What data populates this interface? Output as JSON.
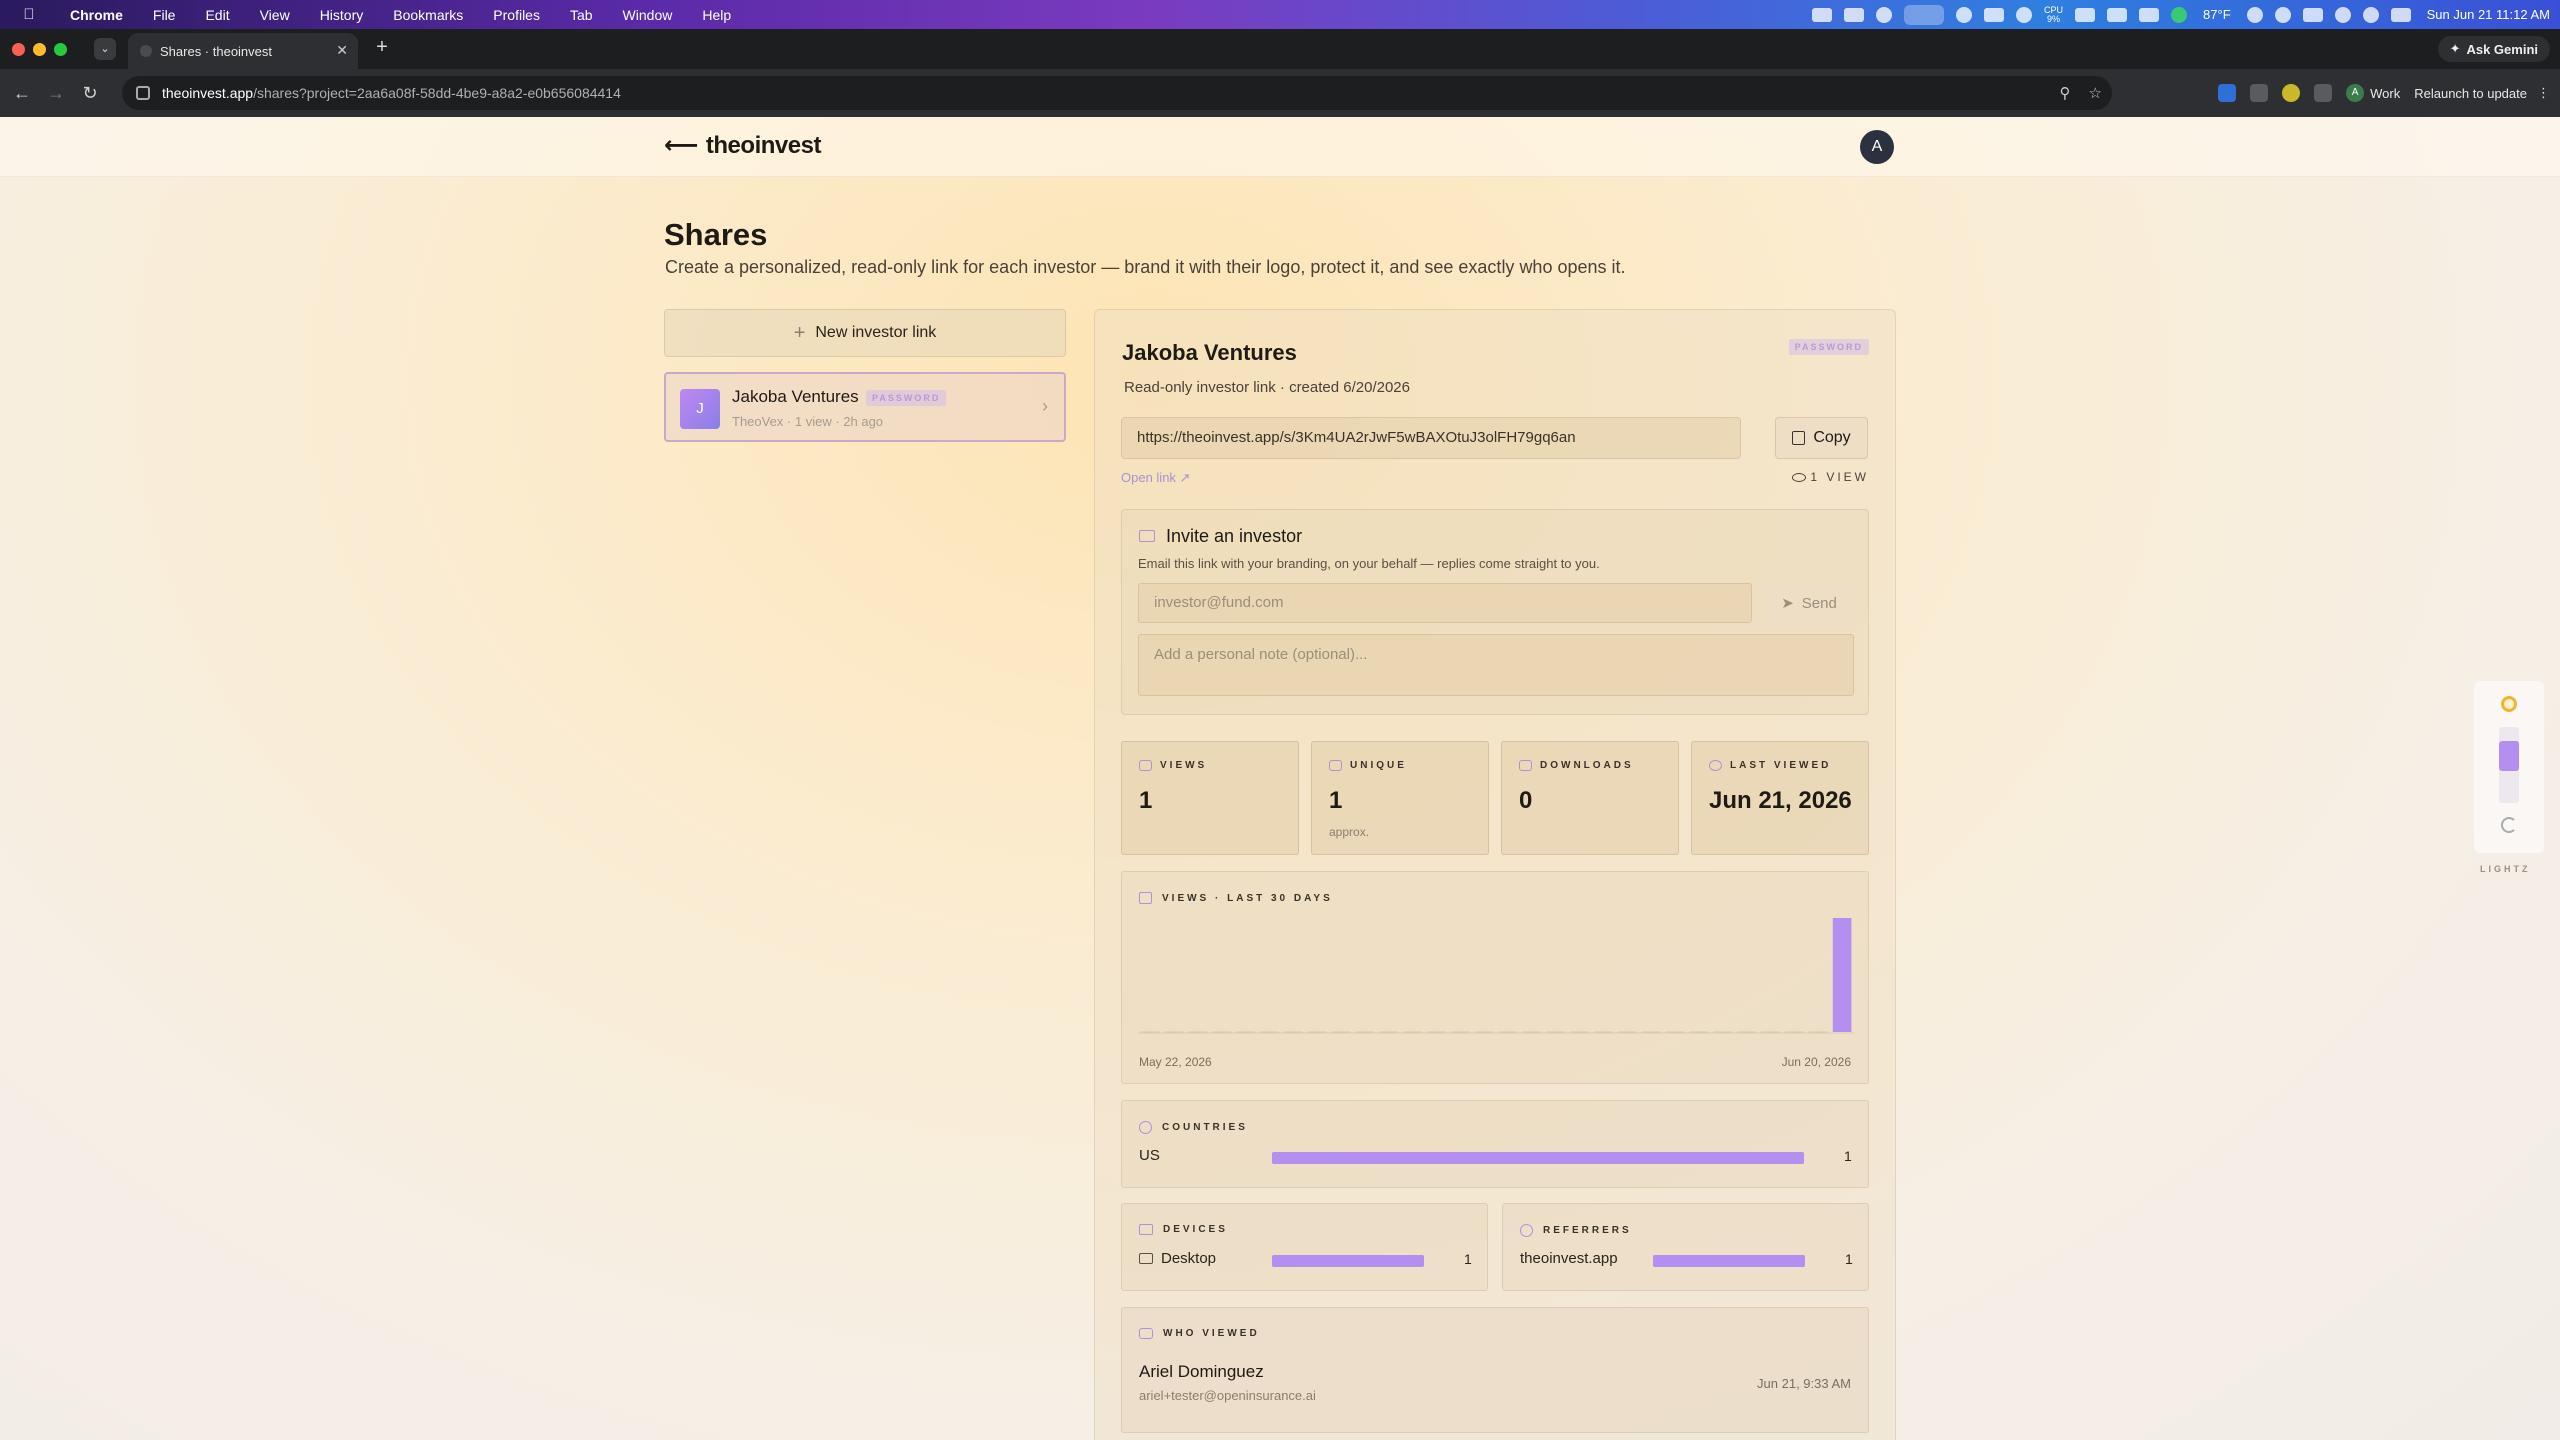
{
  "menubar": {
    "app": "Chrome",
    "items": [
      "File",
      "Edit",
      "View",
      "History",
      "Bookmarks",
      "Profiles",
      "Tab",
      "Window",
      "Help"
    ],
    "cpu_label": "CPU",
    "cpu_value": "9%",
    "temperature": "87°F",
    "datetime": "Sun Jun 21  11:12 AM"
  },
  "browser": {
    "tab_title": "Shares · theoinvest",
    "ask_gemini": "Ask Gemini",
    "url_host": "theoinvest.app",
    "url_path": "/shares?project=2aa6a08f-58dd-4be9-a8a2-e0b656084414",
    "profile_initial": "A",
    "profile_name": "Work",
    "relaunch": "Relaunch to update"
  },
  "header": {
    "logo": "theoinvest",
    "avatar_initial": "A"
  },
  "page": {
    "title": "Shares",
    "subtitle": "Create a personalized, read-only link for each investor — brand it with their logo, protect it, and see exactly who opens it.",
    "new_link_label": "New investor link"
  },
  "investors": [
    {
      "initial": "J",
      "name": "Jakoba Ventures",
      "badge": "PASSWORD",
      "meta": "TheoVex · 1 view · 2h ago"
    }
  ],
  "detail": {
    "name": "Jakoba Ventures",
    "badge": "PASSWORD",
    "subtitle": "Read-only investor link · created 6/20/2026",
    "share_url": "https://theoinvest.app/s/3Km4UA2rJwF5wBAXOtuJ3olFH79gq6an",
    "copy_label": "Copy",
    "open_link_label": "Open link",
    "views_label": "1 VIEW",
    "invite": {
      "title": "Invite an investor",
      "subtitle": "Email this link with your branding, on your behalf — replies come straight to you.",
      "email_placeholder": "investor@fund.com",
      "send_label": "Send",
      "note_placeholder": "Add a personal note (optional)..."
    },
    "stats": [
      {
        "label": "VIEWS",
        "value": "1",
        "sub": ""
      },
      {
        "label": "UNIQUE",
        "value": "1",
        "sub": "approx."
      },
      {
        "label": "DOWNLOADS",
        "value": "0",
        "sub": ""
      },
      {
        "label": "LAST VIEWED",
        "value": "Jun 21, 2026",
        "sub": ""
      }
    ],
    "chart_title": "VIEWS · LAST 30 DAYS",
    "chart_start": "May 22, 2026",
    "chart_end": "Jun 20, 2026",
    "countries": {
      "title": "COUNTRIES",
      "rows": [
        {
          "label": "US",
          "count": "1"
        }
      ]
    },
    "devices": {
      "title": "DEVICES",
      "rows": [
        {
          "label": "Desktop",
          "count": "1"
        }
      ]
    },
    "referrers": {
      "title": "REFERRERS",
      "rows": [
        {
          "label": "theoinvest.app",
          "count": "1"
        }
      ]
    },
    "who_viewed": {
      "title": "WHO VIEWED",
      "viewers": [
        {
          "name": "Ariel Dominguez",
          "email": "ariel+tester@openinsurance.ai",
          "time": "Jun 21, 9:33 AM"
        }
      ]
    }
  },
  "lightz": {
    "label": "LIGHTZ",
    "level": 0.3
  },
  "chart_data": {
    "type": "bar",
    "title": "VIEWS · LAST 30 DAYS",
    "x_start": "May 22, 2026",
    "x_end": "Jun 20, 2026",
    "values": [
      0,
      0,
      0,
      0,
      0,
      0,
      0,
      0,
      0,
      0,
      0,
      0,
      0,
      0,
      0,
      0,
      0,
      0,
      0,
      0,
      0,
      0,
      0,
      0,
      0,
      0,
      0,
      0,
      0,
      1
    ],
    "ylim": [
      0,
      1
    ],
    "color": "#b58ff0"
  },
  "colors": {
    "accent": "#b58ff0",
    "badge_text": "#b89ad4"
  }
}
